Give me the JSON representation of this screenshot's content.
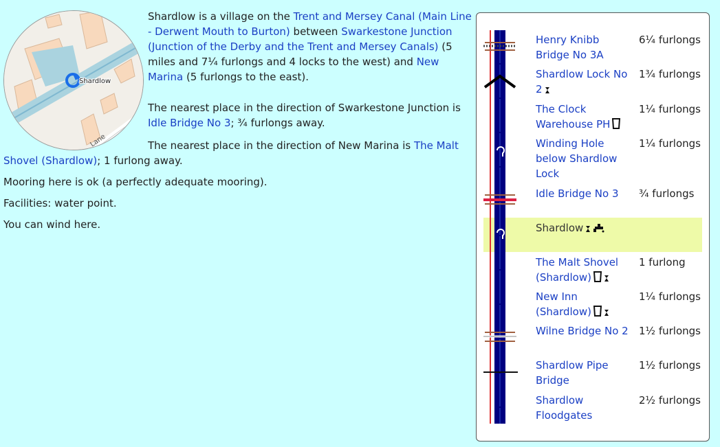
{
  "map": {
    "place_label": "Shardlow",
    "road_label": "Lane"
  },
  "description": {
    "intro_text_1": "Shardlow is a village on the ",
    "canal_link": "Trent and Mersey Canal (Main Line - Derwent Mouth to Burton)",
    "intro_text_2": " between ",
    "west_link": "Swarkestone Junction (Junction of the Derby and the Trent and Mersey Canals)",
    "intro_text_3": " (5 miles and 7¼ furlongs and 4 locks to the west) and ",
    "east_link": "New Marina",
    "intro_text_4": " (5 furlongs to the east).",
    "nearest_west_text": "The nearest place in the direction of Swarkestone Junction is ",
    "nearest_west_link": "Idle Bridge No 3",
    "nearest_west_dist": "; ¾ furlongs away.",
    "nearest_east_text": "The nearest place in the direction of New Marina is ",
    "nearest_east_link": "The Malt Shovel (Shardlow)",
    "nearest_east_dist": "; 1 furlong away.",
    "mooring": "Mooring here is ok (a perfectly adequate mooring).",
    "facilities": "Facilities: water point.",
    "winding": "You can wind here."
  },
  "route": {
    "rows": [
      {
        "name": "Henry Knibb Bridge No 3A",
        "dist": "6¼ furlongs"
      },
      {
        "name": "Shardlow Lock No 2",
        "dist": "1¾ furlongs"
      },
      {
        "name": "The Clock Warehouse PH",
        "dist": "1¼ furlongs"
      },
      {
        "name": "Winding Hole below Shardlow Lock",
        "dist": "1¼ furlongs"
      },
      {
        "name": "Idle Bridge No 3",
        "dist": "¾ furlongs"
      },
      {
        "name": "Shardlow",
        "dist": ""
      },
      {
        "name": "The Malt Shovel (Shardlow)",
        "dist": "1 furlong"
      },
      {
        "name": "New Inn (Shardlow)",
        "dist": "1¼ furlongs"
      },
      {
        "name": "Wilne Bridge No 2",
        "dist": "1½ furlongs"
      },
      {
        "name": "Shardlow Pipe Bridge",
        "dist": "1½ furlongs"
      },
      {
        "name": "Shardlow Floodgates",
        "dist": "2½ furlongs"
      }
    ]
  },
  "colors": {
    "background": "#ccffff",
    "link": "#1a3fc4",
    "canal": "#000080",
    "highlight": "#eefaa8",
    "map_water": "#aad3df"
  }
}
